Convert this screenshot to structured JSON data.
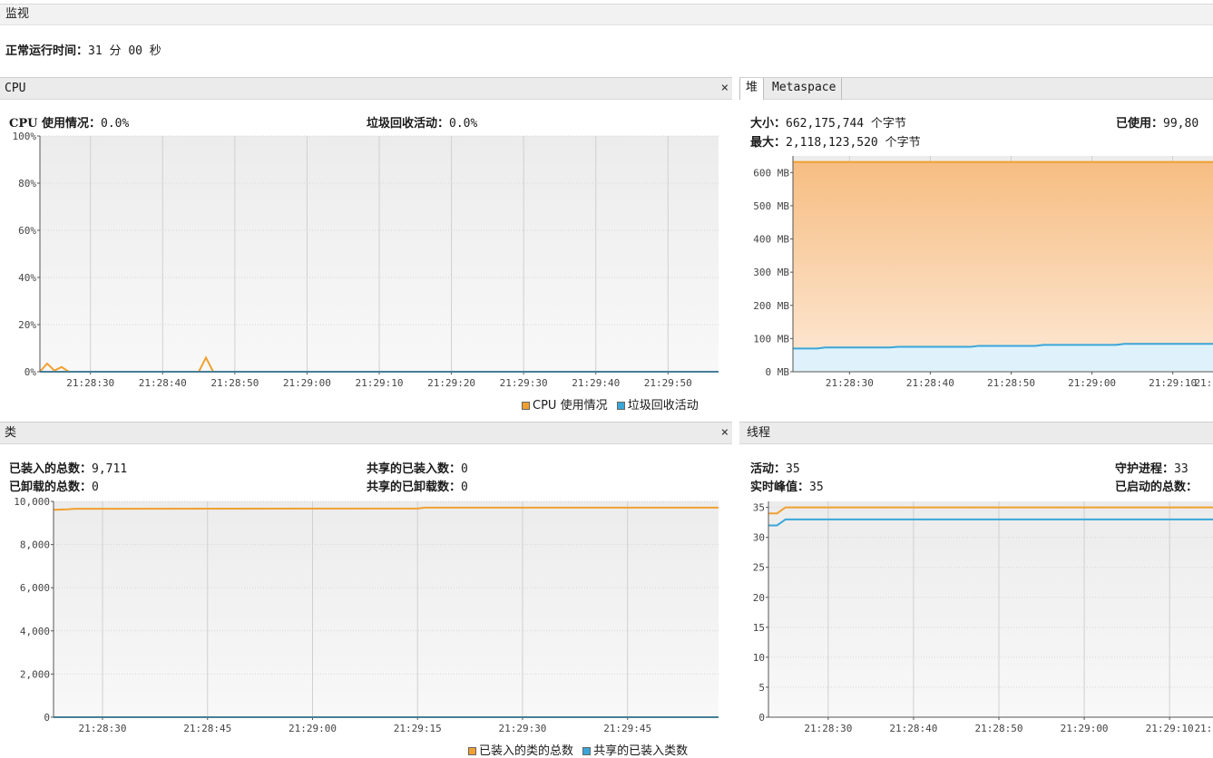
{
  "monitor": {
    "title": "监视",
    "uptime_label": "正常运行时间：",
    "uptime_value": "31 分 00 秒"
  },
  "cpu_panel": {
    "title": "CPU",
    "usage_label": "CPU 使用情况：",
    "usage_value": "0.0%",
    "gc_label": "垃圾回收活动：",
    "gc_value": "0.0%",
    "legend": [
      "CPU 使用情况",
      "垃圾回收活动"
    ]
  },
  "heap_panel": {
    "tabs": [
      "堆",
      "Metaspace"
    ],
    "size_label": "大小：",
    "size_value": "662,175,744 个字节",
    "used_label": "已使用：",
    "used_value": "99,80",
    "max_label": "最大：",
    "max_value": "2,118,123,520 个字节"
  },
  "classes_panel": {
    "title": "类",
    "loaded_label": "已装入的总数：",
    "loaded_value": "9,711",
    "unloaded_label": "已卸载的总数：",
    "unloaded_value": "0",
    "shared_loaded_label": "共享的已装入数：",
    "shared_loaded_value": "0",
    "shared_unloaded_label": "共享的已卸载数：",
    "shared_unloaded_value": "0",
    "legend": [
      "已装入的类的总数",
      "共享的已装入类数"
    ]
  },
  "threads_panel": {
    "title": "线程",
    "live_label": "活动：",
    "live_value": "35",
    "peak_label": "实时峰值：",
    "peak_value": "35",
    "daemon_label": "守护进程：",
    "daemon_value": "33",
    "started_label": "已启动的总数："
  },
  "colors": {
    "orange": "#f0a030",
    "blue": "#3aa6d8",
    "heap_fill": "#f8c28a",
    "heap_used_fill": "#dff2fb"
  },
  "chart_data": [
    {
      "type": "line",
      "name": "cpu",
      "xlabel": "",
      "ylabel": "",
      "ylim": [
        0,
        100
      ],
      "yticks": [
        "0%",
        "20%",
        "40%",
        "60%",
        "80%",
        "100%"
      ],
      "x_ticks": [
        "21:28:30",
        "21:28:40",
        "21:28:50",
        "21:29:00",
        "21:29:10",
        "21:29:20",
        "21:29:30",
        "21:29:40",
        "21:29:50"
      ],
      "x_range": [
        "21:28:23",
        "21:29:57"
      ],
      "series": [
        {
          "name": "CPU 使用情况",
          "color": "orange",
          "points": [
            [
              "21:28:23",
              0
            ],
            [
              "21:28:24",
              3.5
            ],
            [
              "21:28:25",
              0.5
            ],
            [
              "21:28:26",
              2
            ],
            [
              "21:28:27",
              0
            ],
            [
              "21:28:30",
              0
            ],
            [
              "21:28:45",
              0
            ],
            [
              "21:28:46",
              6
            ],
            [
              "21:28:47",
              0
            ],
            [
              "21:29:57",
              0
            ]
          ]
        },
        {
          "name": "垃圾回收活动",
          "color": "blue",
          "points": [
            [
              "21:28:23",
              0
            ],
            [
              "21:29:57",
              0
            ]
          ]
        }
      ]
    },
    {
      "type": "area",
      "name": "heap",
      "ylim": [
        0,
        650
      ],
      "yticks": [
        "0 MB",
        "100 MB",
        "200 MB",
        "300 MB",
        "400 MB",
        "500 MB",
        "600 MB"
      ],
      "x_ticks": [
        "21:28:30",
        "21:28:40",
        "21:28:50",
        "21:29:00",
        "21:29:10",
        "21:29"
      ],
      "x_range": [
        "21:28:23",
        "21:29:17"
      ],
      "series": [
        {
          "name": "大小",
          "color": "orange",
          "points": [
            [
              "21:28:23",
              632
            ],
            [
              "21:29:17",
              632
            ]
          ]
        },
        {
          "name": "已使用",
          "color": "blue",
          "points": [
            [
              "21:28:23",
              70
            ],
            [
              "21:28:26",
              70
            ],
            [
              "21:28:27",
              73
            ],
            [
              "21:28:35",
              73
            ],
            [
              "21:28:36",
              75
            ],
            [
              "21:28:45",
              75
            ],
            [
              "21:28:46",
              78
            ],
            [
              "21:28:53",
              78
            ],
            [
              "21:28:54",
              81
            ],
            [
              "21:29:03",
              81
            ],
            [
              "21:29:04",
              84
            ],
            [
              "21:29:17",
              84
            ]
          ]
        }
      ]
    },
    {
      "type": "line",
      "name": "classes",
      "ylim": [
        0,
        10000
      ],
      "yticks": [
        "0",
        "2,000",
        "4,000",
        "6,000",
        "8,000",
        "10,000"
      ],
      "x_ticks": [
        "21:28:30",
        "21:28:45",
        "21:29:00",
        "21:29:15",
        "21:29:30",
        "21:29:45"
      ],
      "x_range": [
        "21:28:23",
        "21:29:58"
      ],
      "series": [
        {
          "name": "已装入的类的总数",
          "color": "orange",
          "points": [
            [
              "21:28:23",
              9610
            ],
            [
              "21:28:25",
              9630
            ],
            [
              "21:28:26",
              9660
            ],
            [
              "21:29:15",
              9670
            ],
            [
              "21:29:16",
              9711
            ],
            [
              "21:29:58",
              9711
            ]
          ]
        },
        {
          "name": "共享的已装入类数",
          "color": "blue",
          "points": [
            [
              "21:28:23",
              0
            ],
            [
              "21:29:58",
              0
            ]
          ]
        }
      ]
    },
    {
      "type": "line",
      "name": "threads",
      "ylim": [
        0,
        36
      ],
      "yticks": [
        "0",
        "5",
        "10",
        "15",
        "20",
        "25",
        "30",
        "35"
      ],
      "x_ticks": [
        "21:28:30",
        "21:28:40",
        "21:28:50",
        "21:29:00",
        "21:29:10",
        "21:29"
      ],
      "x_range": [
        "21:28:23",
        "21:29:17"
      ],
      "series": [
        {
          "name": "活动",
          "color": "orange",
          "points": [
            [
              "21:28:23",
              34
            ],
            [
              "21:28:24",
              34
            ],
            [
              "21:28:25",
              35
            ],
            [
              "21:29:17",
              35
            ]
          ]
        },
        {
          "name": "守护进程",
          "color": "blue",
          "points": [
            [
              "21:28:23",
              32
            ],
            [
              "21:28:24",
              32
            ],
            [
              "21:28:25",
              33
            ],
            [
              "21:29:17",
              33
            ]
          ]
        }
      ]
    }
  ]
}
